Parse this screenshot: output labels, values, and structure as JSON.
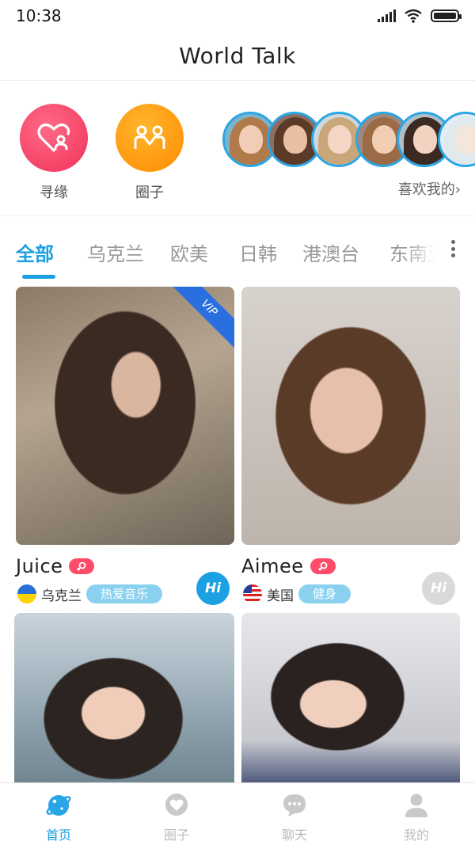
{
  "status_bar": {
    "time": "10:38"
  },
  "header": {
    "title": "World Talk"
  },
  "quick_actions": {
    "find": {
      "label": "寻缘",
      "icon": "heart-person-icon",
      "color": "#f0325a"
    },
    "circle": {
      "label": "圈子",
      "icon": "group-icon",
      "color": "#ff8c00"
    },
    "likes_link": "喜欢我的",
    "likes_chevron": "›"
  },
  "tabs": [
    {
      "label": "全部",
      "active": true
    },
    {
      "label": "乌克兰",
      "active": false
    },
    {
      "label": "欧美",
      "active": false
    },
    {
      "label": "日韩",
      "active": false
    },
    {
      "label": "港澳台",
      "active": false
    },
    {
      "label": "东南亚",
      "active": false
    }
  ],
  "cards": [
    {
      "name": "Juice",
      "country": "乌克兰",
      "flag": "ukraine-flag",
      "interest": "热爱音乐",
      "vip": "VIP",
      "hi": "Hi",
      "hi_active": true
    },
    {
      "name": "Aimee",
      "country": "美国",
      "flag": "usa-flag",
      "interest": "健身",
      "hi": "Hi",
      "hi_active": false
    },
    {
      "name": "",
      "country": "",
      "interest": ""
    },
    {
      "name": "",
      "country": "",
      "interest": ""
    }
  ],
  "bottom_nav": [
    {
      "label": "首页",
      "icon": "planet-icon",
      "active": true
    },
    {
      "label": "圈子",
      "icon": "heart-bubble-icon",
      "active": false
    },
    {
      "label": "聊天",
      "icon": "chat-bubble-icon",
      "active": false
    },
    {
      "label": "我的",
      "icon": "person-icon",
      "active": false
    }
  ],
  "colors": {
    "accent": "#1ba0e1",
    "vip": "#2a6fe0",
    "gender": "#ff4c6a",
    "tag": "#8ad1ef"
  }
}
